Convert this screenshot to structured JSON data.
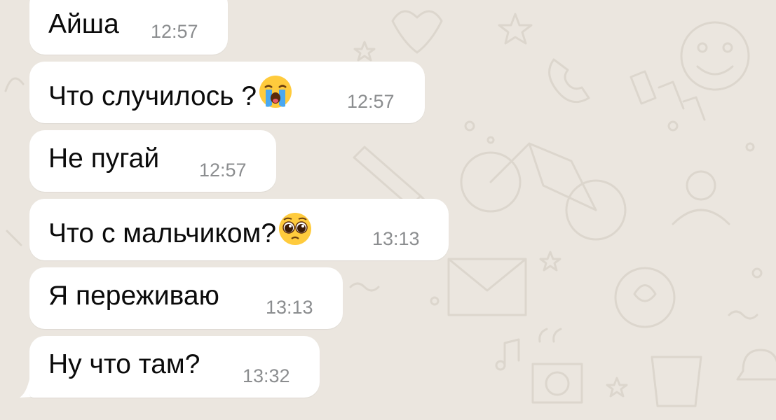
{
  "colors": {
    "wallpaper": "#ebe6df",
    "bubble_incoming": "#ffffff",
    "timestamp": "#8b8d8f",
    "message_text": "#0b0b0b"
  },
  "messages": [
    {
      "text": "Айша",
      "time": "12:57"
    },
    {
      "text": "Что случилось ?",
      "emoji": "loudly-crying-face-icon",
      "time": "12:57"
    },
    {
      "text": "Не пугай",
      "time": "12:57"
    },
    {
      "text": "Что с мальчиком?",
      "emoji": "pleading-face-icon",
      "time": "13:13"
    },
    {
      "text": "Я переживаю",
      "time": "13:13"
    },
    {
      "text": "Ну что там?",
      "time": "13:32"
    }
  ]
}
